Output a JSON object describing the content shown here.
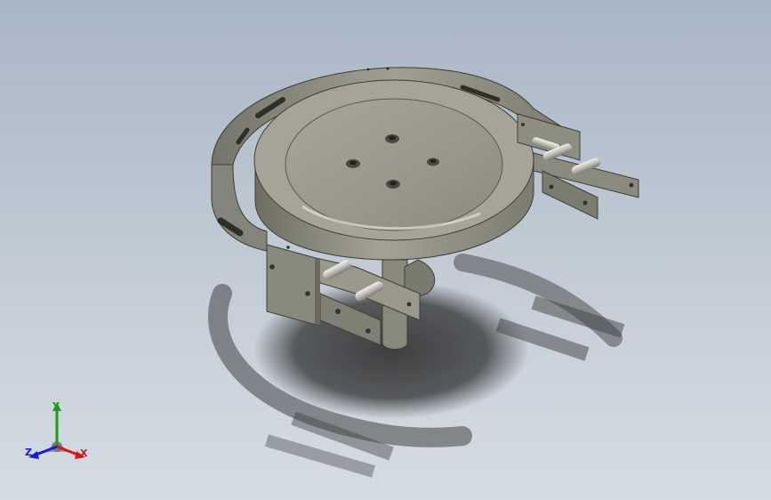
{
  "viewport": {
    "background_top": "#a9b6c6",
    "background_bottom": "#d6dce3"
  },
  "model": {
    "part_color": "#8e8d80",
    "part_highlight": "#b8b7aa",
    "shadow_color": "#2a2a2a"
  },
  "triad": {
    "x_label": "X",
    "y_label": "Y",
    "z_label": "Z",
    "x_color": "#d21818",
    "y_color": "#1f9a1f",
    "z_color": "#1b1bd2"
  }
}
